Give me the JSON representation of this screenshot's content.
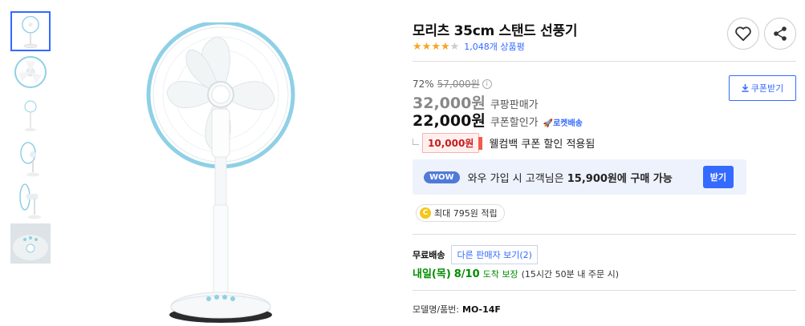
{
  "product": {
    "title": "모리츠 35cm 스탠드 선풍기",
    "rating_stars": 4,
    "rating_max": 5,
    "review_count": "1,048개 상품평"
  },
  "pricing": {
    "discount_rate": "72%",
    "original_price": "57,000원",
    "sale_price": "32,000원",
    "sale_price_label": "쿠팡판매가",
    "coupon_price": "22,000원",
    "coupon_price_label": "쿠폰할인가",
    "rocket_label": "로켓배송",
    "coupon_button": "쿠폰받기"
  },
  "welcome": {
    "amount": "10,000원",
    "text": "웰컴백 쿠폰 할인 적용됨"
  },
  "wow": {
    "badge": "WOW",
    "prefix": "와우 가입 시 고객님은",
    "amount": "15,900원에 구매 가능",
    "button": "받기"
  },
  "points": {
    "coin": "C",
    "text": "최대 795원 적립"
  },
  "shipping": {
    "label": "무료배송",
    "other_sellers": "다른 판매자 보기(2)",
    "arrival_day": "내일(목)",
    "arrival_date": "8/10",
    "arrival_text": "도착 보장",
    "arrival_condition": "(15시간 50분 내 주문 시)"
  },
  "model": {
    "label": "모델명/품번:",
    "value": "MO-14F"
  },
  "thumbnails": [
    {
      "name": "fan-front"
    },
    {
      "name": "fan-head-front"
    },
    {
      "name": "fan-small-front"
    },
    {
      "name": "fan-side"
    },
    {
      "name": "fan-side-close"
    },
    {
      "name": "fan-control-panel"
    }
  ],
  "colors": {
    "accent": "#346aff",
    "star": "#f5a623",
    "welcome_red": "#c8191d",
    "arrival_green": "#008c00",
    "fan_ring": "#8fd0e6"
  }
}
